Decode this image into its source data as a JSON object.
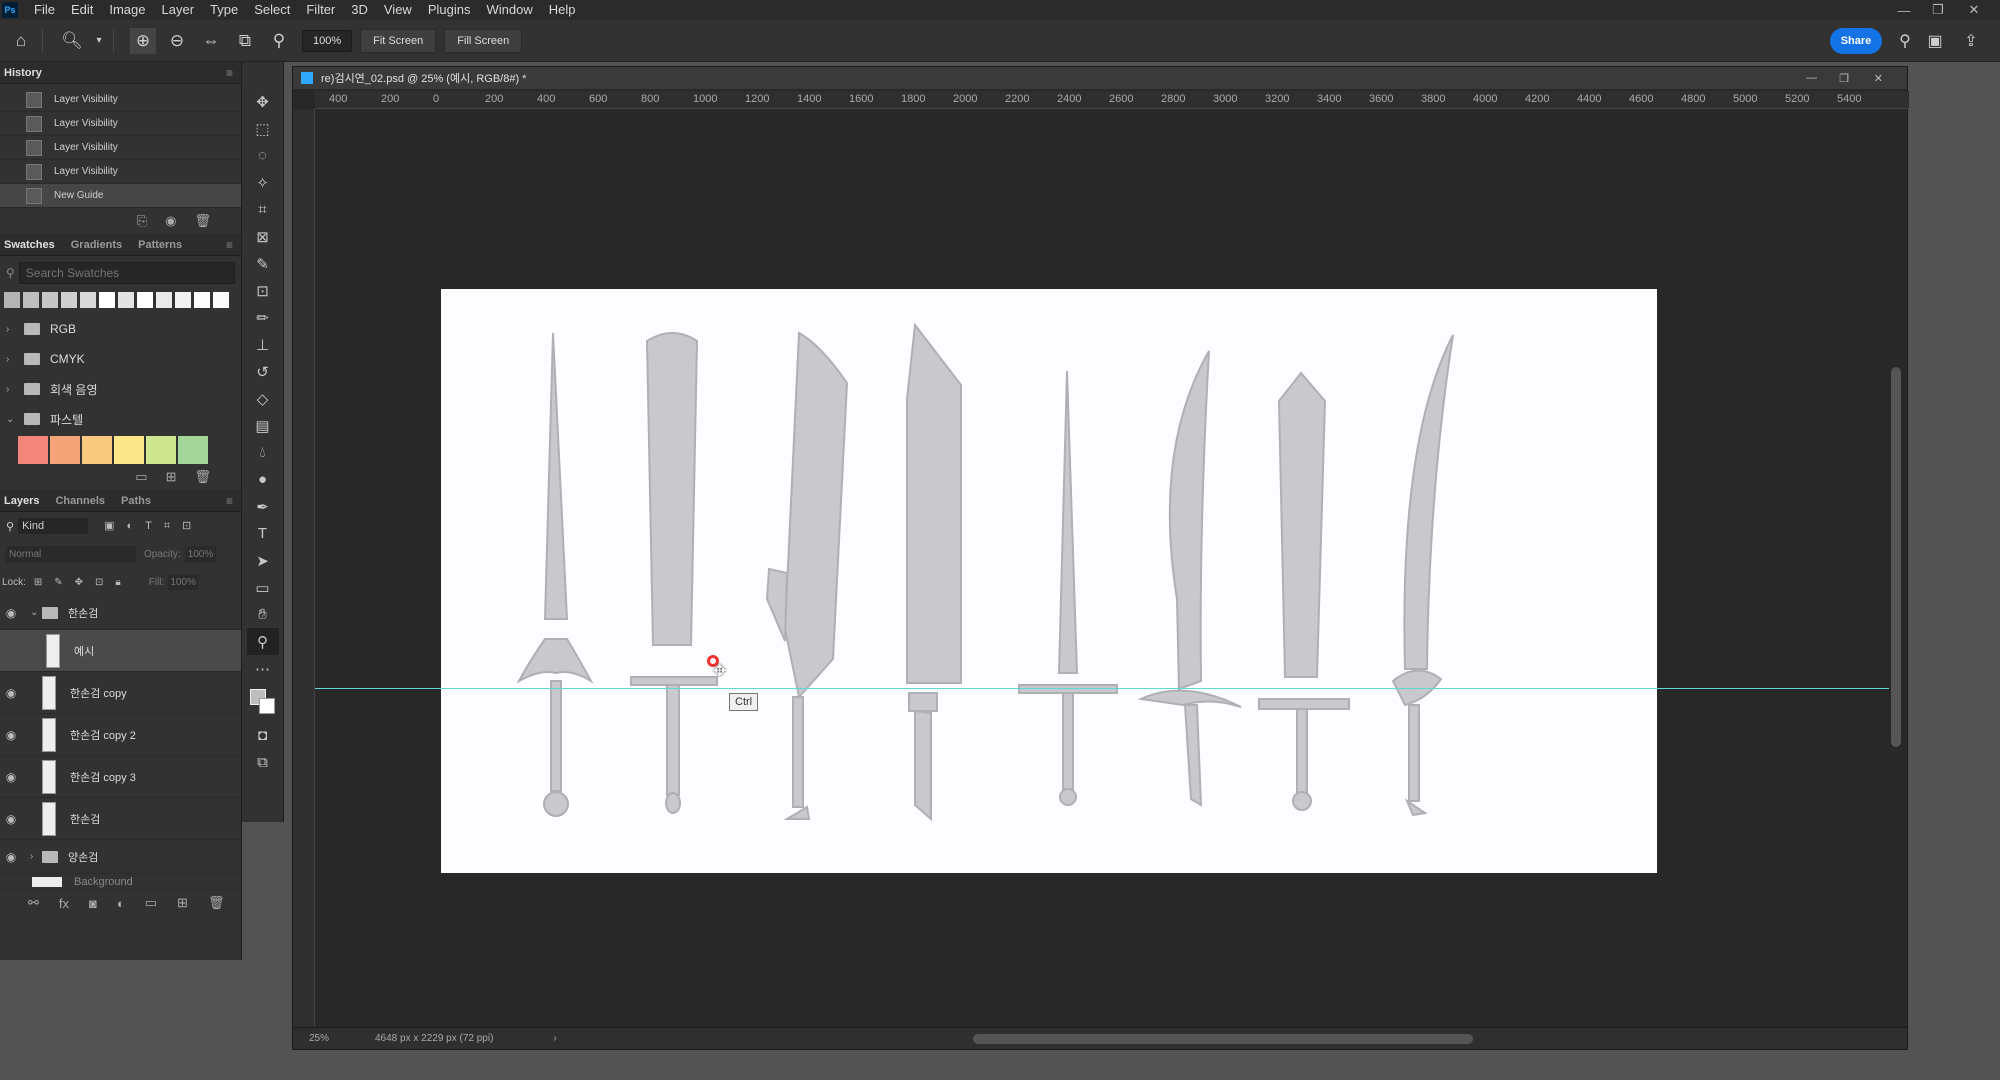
{
  "menubar": {
    "items": [
      "File",
      "Edit",
      "Image",
      "Layer",
      "Type",
      "Select",
      "Filter",
      "3D",
      "View",
      "Plugins",
      "Window",
      "Help"
    ]
  },
  "options": {
    "zoom_value": "100%",
    "fit_screen": "Fit Screen",
    "fill_screen": "Fill Screen",
    "share_label": "Share"
  },
  "history": {
    "title": "History",
    "items": [
      "Layer Visibility",
      "Layer Visibility",
      "Layer Visibility",
      "Layer Visibility",
      "New Guide"
    ]
  },
  "swatches": {
    "tabs": [
      "Swatches",
      "Gradients",
      "Patterns"
    ],
    "search_placeholder": "Search Swatches",
    "folders": [
      "RGB",
      "CMYK",
      "회색 음영",
      "파스텔"
    ],
    "gray_colors": [
      "#b4b4b4",
      "#bdbdbd",
      "#c6c6c6",
      "#cfcfcf",
      "#d8d8d8",
      "#ffffff",
      "#e4e4e4",
      "#ffffff",
      "#eaeaea",
      "#f2f2f2",
      "#ffffff",
      "#fafafa"
    ],
    "pastel_colors": [
      "#f2867a",
      "#f5a47a",
      "#f8c97f",
      "#fbe789",
      "#cfe58f",
      "#a4d69a"
    ]
  },
  "layers": {
    "tabs": [
      "Layers",
      "Channels",
      "Paths"
    ],
    "kind_label": "Kind",
    "blend_mode": "Normal",
    "opacity_label": "Opacity:",
    "opacity_value": "100%",
    "lock_label": "Lock:",
    "fill_label": "Fill:",
    "fill_value": "100%",
    "items": [
      {
        "name": "한손검",
        "type": "group"
      },
      {
        "name": "예시",
        "type": "layer"
      },
      {
        "name": "한손검 copy",
        "type": "layer"
      },
      {
        "name": "한손검 copy 2",
        "type": "layer"
      },
      {
        "name": "한손검 copy 3",
        "type": "layer"
      },
      {
        "name": "한손검",
        "type": "layer"
      },
      {
        "name": "양손검",
        "type": "group"
      },
      {
        "name": "Background",
        "type": "layer"
      }
    ]
  },
  "document": {
    "tab_title": "re)검시연_02.psd @ 25% (예시, RGB/8#) *",
    "ruler_labels": [
      "400",
      "200",
      "0",
      "200",
      "400",
      "600",
      "800",
      "1000",
      "1200",
      "1400",
      "1600",
      "1800",
      "2000",
      "2200",
      "2400",
      "2600",
      "2800",
      "3000",
      "3200",
      "3400",
      "3600",
      "3800",
      "4000",
      "4200",
      "4400",
      "4600",
      "4800",
      "5000",
      "5200",
      "5400"
    ],
    "status_zoom": "25%",
    "status_info": "4648 px x 2229 px (72 ppi)",
    "tooltip": "Ctrl"
  },
  "colors": {
    "accent": "#1473e6",
    "guide": "#5fd7d4",
    "canvas_bg": "#fdfcfe",
    "sword_fill": "#c9c8cc"
  }
}
